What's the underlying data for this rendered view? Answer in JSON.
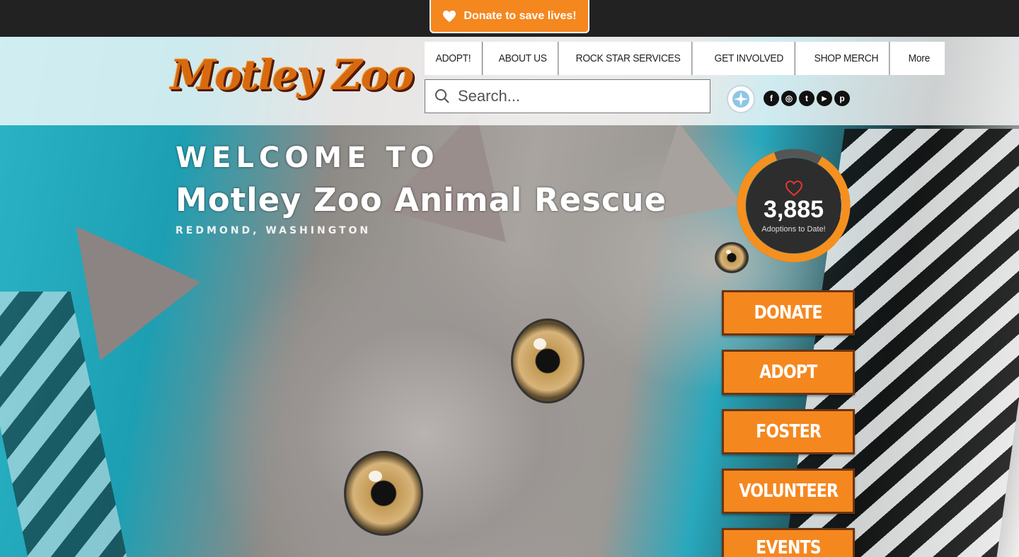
{
  "topbar": {
    "donate_label": "Donate to save lives!"
  },
  "header": {
    "logo_text": "Motley Zoo",
    "nav": [
      "ADOPT!",
      "ABOUT US",
      "ROCK STAR SERVICES",
      "GET INVOLVED",
      "SHOP MERCH",
      "More"
    ],
    "search_placeholder": "Search...",
    "social": [
      {
        "icon": "facebook-icon",
        "glyph": "f"
      },
      {
        "icon": "instagram-icon",
        "glyph": "◎"
      },
      {
        "icon": "twitter-icon",
        "glyph": "t"
      },
      {
        "icon": "youtube-icon",
        "glyph": "▶"
      },
      {
        "icon": "pinterest-icon",
        "glyph": "p"
      }
    ]
  },
  "hero": {
    "welcome": "WELCOME TO",
    "title": "Motley Zoo Animal Rescue",
    "location": "REDMOND, WASHINGTON"
  },
  "counter": {
    "value": "3,885",
    "label": "Adoptions to Date!"
  },
  "cta": [
    "DONATE",
    "ADOPT",
    "FOSTER",
    "VOLUNTEER",
    "EVENTS"
  ],
  "colors": {
    "accent": "#f5871f",
    "dark": "#222222"
  }
}
